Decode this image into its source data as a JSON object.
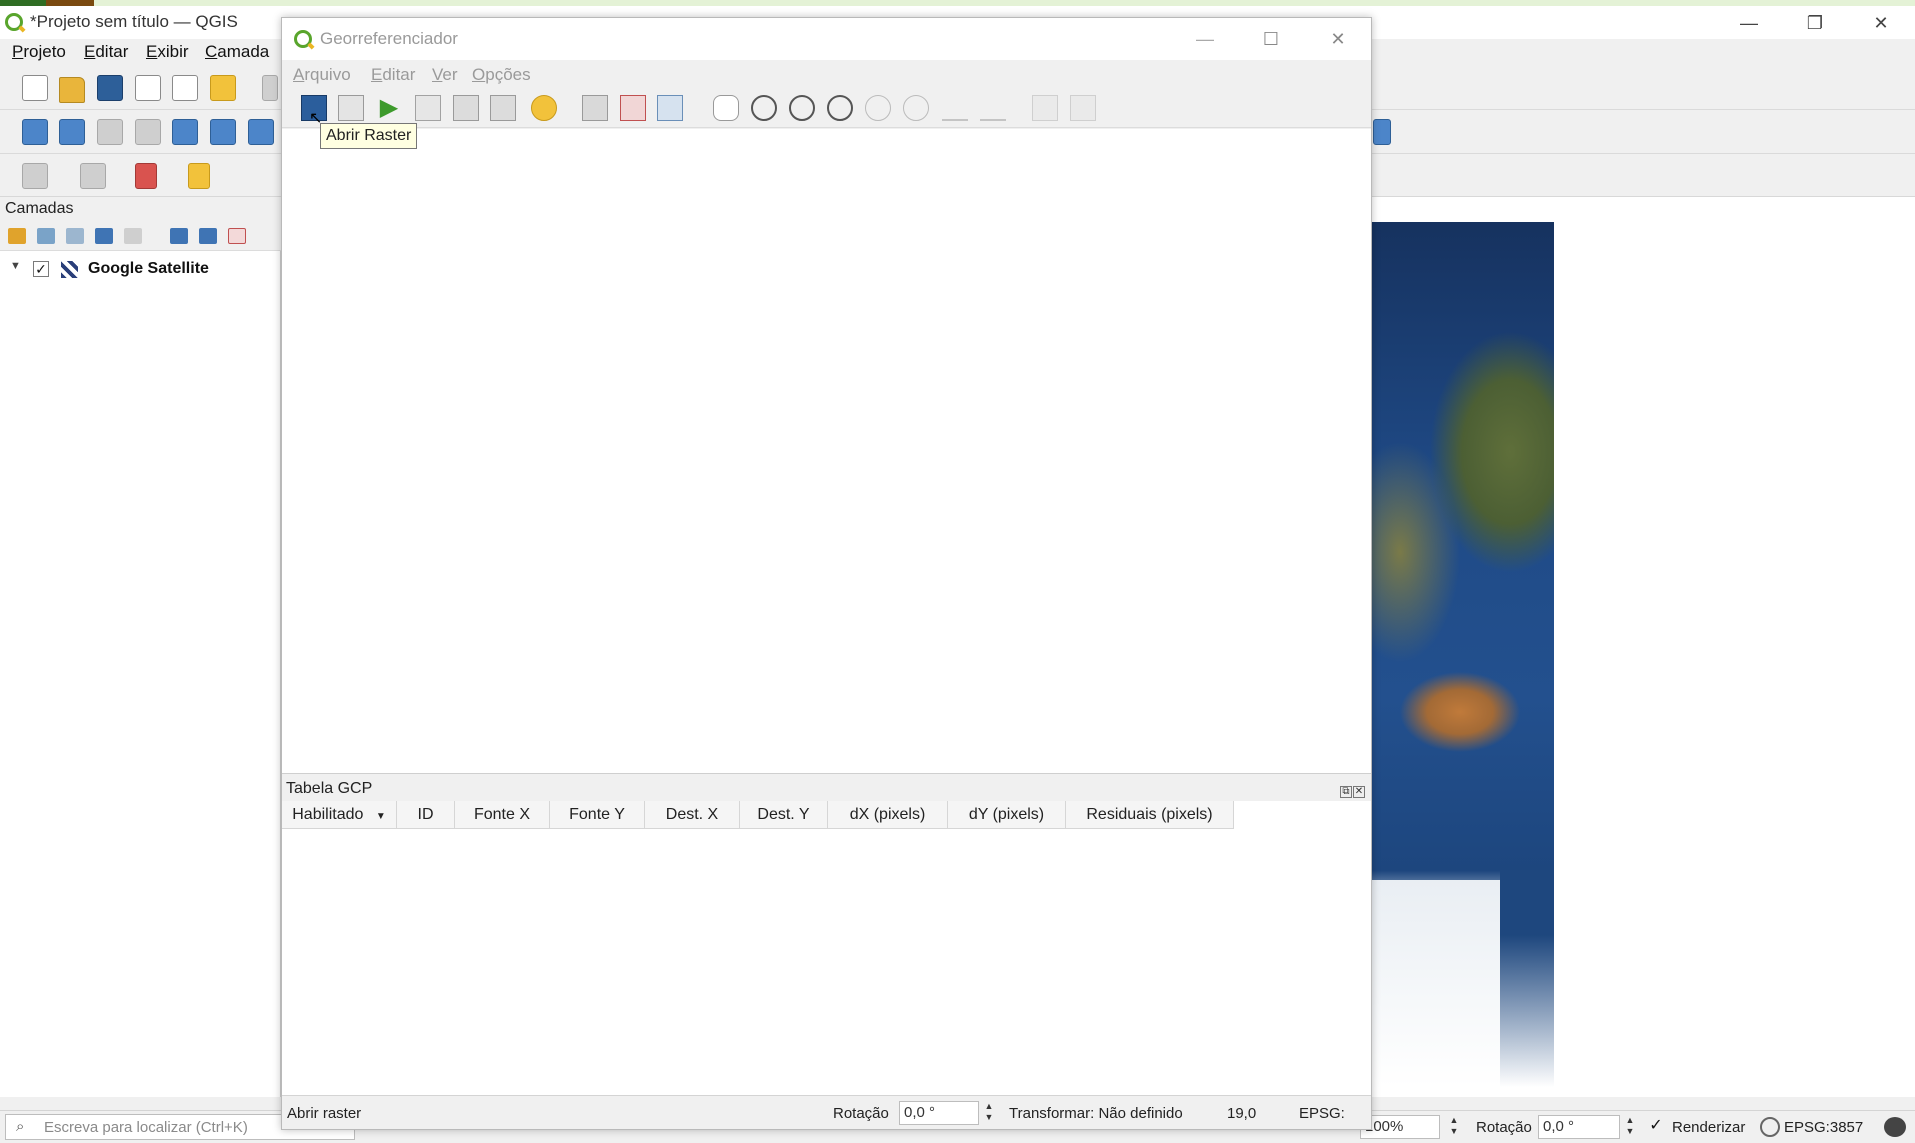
{
  "main_window": {
    "title": "*Projeto sem título — QGIS",
    "menu": [
      "Projeto",
      "Editar",
      "Exibir",
      "Camada"
    ],
    "window_controls": {
      "minimize": "—",
      "restore": "❐",
      "close": "✕"
    }
  },
  "layers_panel": {
    "title": "Camadas",
    "layers": [
      {
        "name": "Google Satellite",
        "checked": "✓",
        "expand": "▼"
      }
    ]
  },
  "main_statusbar": {
    "locator_placeholder": "Escreva para localizar (Ctrl+K)",
    "scale_value": "100%",
    "rotation_label": "Rotação",
    "rotation_value": "0,0 °",
    "render_checked": "✓",
    "render_label": "Renderizar",
    "crs": "EPSG:3857"
  },
  "georef": {
    "title": "Georreferenciador",
    "menu": [
      "Arquivo",
      "Editar",
      "Ver",
      "Opções"
    ],
    "window_controls": {
      "minimize": "—",
      "maximize": "☐",
      "close": "✕"
    },
    "tooltip": "Abrir Raster",
    "gcp": {
      "title": "Tabela GCP",
      "columns": [
        "Habilitado",
        "ID",
        "Fonte X",
        "Fonte Y",
        "Dest. X",
        "Dest. Y",
        "dX (pixels)",
        "dY (pixels)",
        "Residuais (pixels)"
      ],
      "sort_arrow": "▼"
    },
    "statusbar": {
      "left_text": "Abrir raster",
      "rotation_label": "Rotação",
      "rotation_value": "0,0 °",
      "transform": "Transformar: Não definido",
      "number": "19,0",
      "epsg": "EPSG:"
    }
  },
  "colors": {
    "qgis_green": "#59a52c",
    "tooltip_bg": "#ffffe1",
    "disabled_text": "#9a9a9a"
  }
}
